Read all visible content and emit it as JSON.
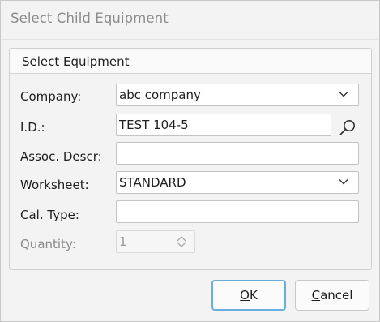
{
  "window": {
    "title": "Select Child Equipment"
  },
  "group": {
    "title": "Select Equipment"
  },
  "fields": {
    "company": {
      "label": "Company:",
      "value": "abc company"
    },
    "id": {
      "label": "I.D.:",
      "value": "TEST 104-5"
    },
    "assoc_descr": {
      "label": "Assoc. Descr:",
      "value": ""
    },
    "worksheet": {
      "label": "Worksheet:",
      "value": "STANDARD"
    },
    "cal_type": {
      "label": "Cal. Type:",
      "value": ""
    },
    "quantity": {
      "label": "Quantity:",
      "value": "1"
    }
  },
  "buttons": {
    "ok": {
      "mnemonic": "O",
      "rest": "K"
    },
    "cancel": {
      "mnemonic": "C",
      "rest": "ancel"
    }
  },
  "colors": {
    "accent_border": "#6aaee0",
    "disabled_text": "#8a8a8a"
  },
  "icons": {
    "dropdown": "chevron-down-icon",
    "lookup": "search-icon",
    "spinner": "spinner-arrows-icon"
  }
}
